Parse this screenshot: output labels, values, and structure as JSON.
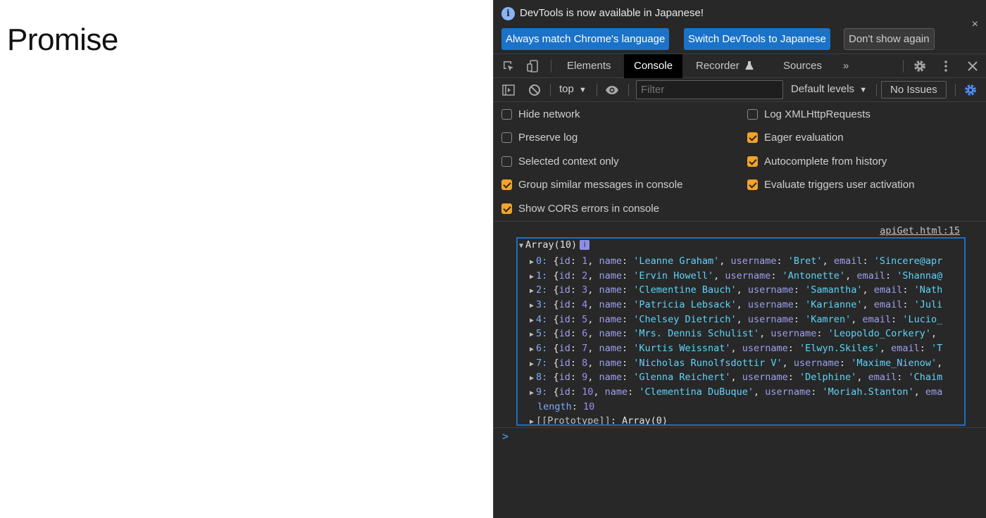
{
  "page": {
    "title": "Promise"
  },
  "infobar": {
    "message": "DevTools is now available in Japanese!",
    "buttons": [
      "Always match Chrome's language",
      "Switch DevTools to Japanese",
      "Don't show again"
    ],
    "close": "×"
  },
  "tabs": {
    "items": [
      "Elements",
      "Console",
      "Recorder",
      "Sources"
    ],
    "active": "Console",
    "more": "»"
  },
  "toolbar": {
    "context": "top",
    "filter_placeholder": "Filter",
    "levels": "Default levels",
    "issues": "No Issues"
  },
  "settings": {
    "left": [
      {
        "label": "Hide network",
        "checked": false
      },
      {
        "label": "Preserve log",
        "checked": false
      },
      {
        "label": "Selected context only",
        "checked": false
      },
      {
        "label": "Group similar messages in console",
        "checked": true
      },
      {
        "label": "Show CORS errors in console",
        "checked": true
      }
    ],
    "right": [
      {
        "label": "Log XMLHttpRequests",
        "checked": false
      },
      {
        "label": "Eager evaluation",
        "checked": true
      },
      {
        "label": "Autocomplete from history",
        "checked": true
      },
      {
        "label": "Evaluate triggers user activation",
        "checked": true
      }
    ]
  },
  "console": {
    "source": "apiGet.html:15",
    "array_header": "Array(10)",
    "entries": [
      {
        "index": "0",
        "id": "1",
        "name": "'Leanne Graham'",
        "username": "'Bret'",
        "tail_key": "email",
        "tail_val": "'Sincere@apr"
      },
      {
        "index": "1",
        "id": "2",
        "name": "'Ervin Howell'",
        "username": "'Antonette'",
        "tail_key": "email",
        "tail_val": "'Shanna@"
      },
      {
        "index": "2",
        "id": "3",
        "name": "'Clementine Bauch'",
        "username": "'Samantha'",
        "tail_key": "email",
        "tail_val": "'Nath"
      },
      {
        "index": "3",
        "id": "4",
        "name": "'Patricia Lebsack'",
        "username": "'Karianne'",
        "tail_key": "email",
        "tail_val": "'Juli"
      },
      {
        "index": "4",
        "id": "5",
        "name": "'Chelsey Dietrich'",
        "username": "'Kamren'",
        "tail_key": "email",
        "tail_val": "'Lucio_"
      },
      {
        "index": "5",
        "id": "6",
        "name": "'Mrs. Dennis Schulist'",
        "username": "'Leopoldo_Corkery'",
        "tail_key": "",
        "tail_val": ""
      },
      {
        "index": "6",
        "id": "7",
        "name": "'Kurtis Weissnat'",
        "username": "'Elwyn.Skiles'",
        "tail_key": "email",
        "tail_val": "'T"
      },
      {
        "index": "7",
        "id": "8",
        "name": "'Nicholas Runolfsdottir V'",
        "username": "'Maxime_Nienow'",
        "tail_key": "",
        "tail_val": ""
      },
      {
        "index": "8",
        "id": "9",
        "name": "'Glenna Reichert'",
        "username": "'Delphine'",
        "tail_key": "email",
        "tail_val": "'Chaim"
      },
      {
        "index": "9",
        "id": "10",
        "name": "'Clementina DuBuque'",
        "username": "'Moriah.Stanton'",
        "tail_key": "ema",
        "tail_val": ""
      }
    ],
    "length_key": "length",
    "length_val": "10",
    "prototype_key": "[[Prototype]]",
    "prototype_val": "Array(0)",
    "prompt": ">"
  }
}
